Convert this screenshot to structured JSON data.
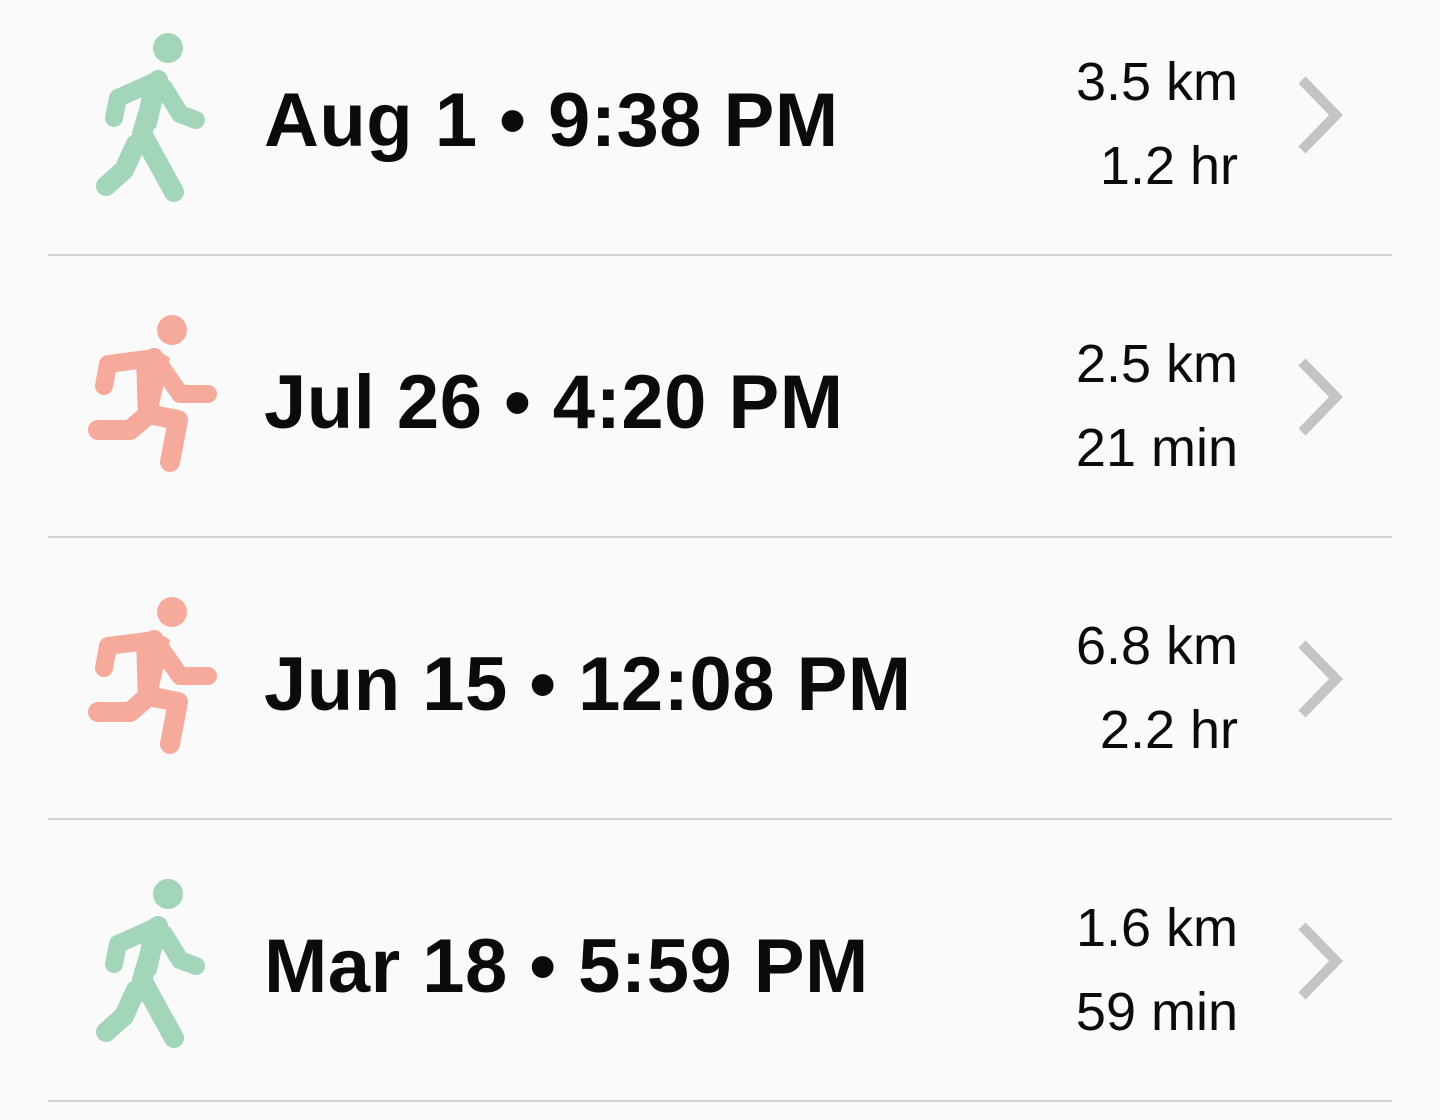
{
  "colors": {
    "walk": "#a3d5bb",
    "run": "#f5aa9c",
    "chevron": "#c4c4c4",
    "divider": "#d2d2d2"
  },
  "activities": [
    {
      "type": "walk",
      "icon": "walking-person-icon",
      "title": "Aug 1 • 9:38 PM",
      "distance": "3.5 km",
      "duration": "1.2 hr"
    },
    {
      "type": "run",
      "icon": "running-person-icon",
      "title": "Jul 26 • 4:20 PM",
      "distance": "2.5 km",
      "duration": "21 min"
    },
    {
      "type": "run",
      "icon": "running-person-icon",
      "title": "Jun 15 • 12:08 PM",
      "distance": "6.8 km",
      "duration": "2.2 hr"
    },
    {
      "type": "walk",
      "icon": "walking-person-icon",
      "title": "Mar 18 • 5:59 PM",
      "distance": "1.6 km",
      "duration": "59 min"
    }
  ]
}
